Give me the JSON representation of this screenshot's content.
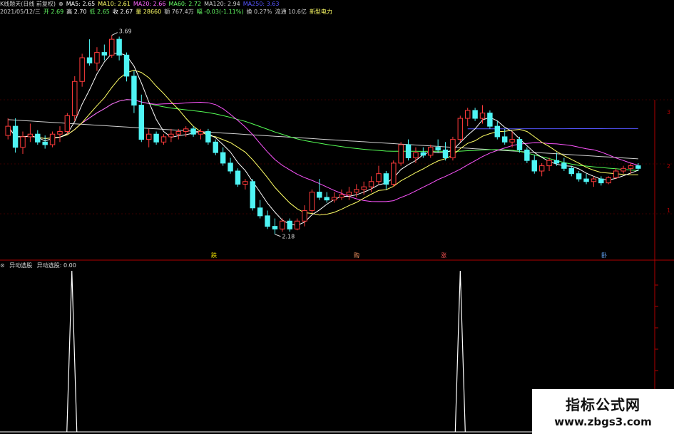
{
  "header": {
    "line1": [
      {
        "text": "K线题天(日线 前复权)",
        "color": "#d0d0d0"
      },
      {
        "text": "⊗",
        "color": "#d0d0d0"
      },
      {
        "text": "MA5: 2.65",
        "color": "#ffffff"
      },
      {
        "text": "MA10: 2.61",
        "color": "#ffff66"
      },
      {
        "text": "MA20: 2.66",
        "color": "#ff66ff"
      },
      {
        "text": "MA60: 2.72",
        "color": "#66ff66"
      },
      {
        "text": "MA120: 2.94",
        "color": "#d0d0d0"
      },
      {
        "text": "MA250: 3.63",
        "color": "#5555ff"
      }
    ],
    "line2": [
      {
        "text": "2021/05/12/三",
        "color": "#d0d0d0"
      },
      {
        "text": "开 2.69",
        "color": "#66ff66"
      },
      {
        "text": "高 2.70",
        "color": "#ffffff"
      },
      {
        "text": "低 2.65",
        "color": "#66ff66"
      },
      {
        "text": "收 2.67",
        "color": "#ffffff"
      },
      {
        "text": "量 28660",
        "color": "#ffff66"
      },
      {
        "text": "额 767.4万",
        "color": "#d0d0d0"
      },
      {
        "text": "幅 -0.03(-1.11%)",
        "color": "#66ff66"
      },
      {
        "text": "换 0.27%",
        "color": "#d0d0d0"
      },
      {
        "text": "流通 10.6亿",
        "color": "#d0d0d0"
      },
      {
        "text": "新型电力",
        "color": "#ffff66"
      }
    ]
  },
  "subpanel": {
    "title": "异动选股",
    "value_label": "异动选股: 0.00"
  },
  "markers": [
    {
      "label": "跌",
      "color": "#ffee00"
    },
    {
      "label": "购",
      "color": "#ff9966"
    },
    {
      "label": "涨",
      "color": "#ff5555"
    },
    {
      "label": "卧",
      "color": "#66aaff"
    }
  ],
  "annotations": {
    "high": "3.69",
    "low": "2.18"
  },
  "axis_labels": [
    "3",
    "2",
    "1"
  ],
  "watermark": {
    "title": "指标公式网",
    "url": "www.zbgs3.com"
  },
  "colors": {
    "up": "#ff3b3b",
    "down": "#4ff4f4",
    "ma5": "#ffffff",
    "ma10": "#ffff66",
    "ma20": "#ff55ff",
    "ma60": "#55ff55",
    "ma120": "#d0d0d0",
    "ma250": "#5555ff"
  },
  "chart_data": {
    "type": "candlestick",
    "ylim": [
      2.0,
      3.85
    ],
    "candles": [
      [
        2.93,
        3.06,
        2.9,
        3.0
      ],
      [
        3.0,
        3.06,
        2.8,
        2.84
      ],
      [
        2.84,
        2.96,
        2.79,
        2.92
      ],
      [
        2.92,
        3.02,
        2.88,
        2.94
      ],
      [
        2.94,
        2.97,
        2.86,
        2.88
      ],
      [
        2.88,
        2.93,
        2.83,
        2.86
      ],
      [
        2.86,
        2.96,
        2.84,
        2.94
      ],
      [
        2.94,
        3.0,
        2.88,
        2.96
      ],
      [
        2.96,
        3.1,
        2.94,
        3.08
      ],
      [
        3.08,
        3.38,
        3.04,
        3.34
      ],
      [
        3.34,
        3.55,
        3.3,
        3.52
      ],
      [
        3.52,
        3.66,
        3.46,
        3.48
      ],
      [
        3.48,
        3.6,
        3.42,
        3.56
      ],
      [
        3.56,
        3.62,
        3.5,
        3.54
      ],
      [
        3.54,
        3.69,
        3.52,
        3.66
      ],
      [
        3.66,
        3.68,
        3.5,
        3.54
      ],
      [
        3.54,
        3.56,
        3.34,
        3.38
      ],
      [
        3.38,
        3.42,
        3.1,
        3.16
      ],
      [
        3.16,
        3.24,
        2.88,
        2.9
      ],
      [
        2.9,
        2.98,
        2.84,
        2.94
      ],
      [
        2.94,
        2.96,
        2.86,
        2.88
      ],
      [
        2.88,
        2.94,
        2.86,
        2.92
      ],
      [
        2.92,
        2.98,
        2.88,
        2.94
      ],
      [
        2.94,
        2.98,
        2.9,
        2.96
      ],
      [
        2.96,
        3.0,
        2.92,
        2.98
      ],
      [
        2.98,
        3.0,
        2.92,
        2.94
      ],
      [
        2.94,
        2.98,
        2.9,
        2.96
      ],
      [
        2.96,
        2.98,
        2.86,
        2.88
      ],
      [
        2.88,
        2.9,
        2.78,
        2.8
      ],
      [
        2.8,
        2.84,
        2.7,
        2.72
      ],
      [
        2.72,
        2.76,
        2.64,
        2.66
      ],
      [
        2.66,
        2.68,
        2.54,
        2.56
      ],
      [
        2.56,
        2.6,
        2.52,
        2.58
      ],
      [
        2.58,
        2.6,
        2.36,
        2.38
      ],
      [
        2.38,
        2.44,
        2.3,
        2.32
      ],
      [
        2.32,
        2.36,
        2.22,
        2.24
      ],
      [
        2.24,
        2.3,
        2.18,
        2.22
      ],
      [
        2.22,
        2.3,
        2.2,
        2.28
      ],
      [
        2.28,
        2.3,
        2.2,
        2.22
      ],
      [
        2.22,
        2.3,
        2.21,
        2.28
      ],
      [
        2.28,
        2.4,
        2.24,
        2.36
      ],
      [
        2.36,
        2.52,
        2.34,
        2.5
      ],
      [
        2.5,
        2.6,
        2.44,
        2.46
      ],
      [
        2.46,
        2.5,
        2.42,
        2.44
      ],
      [
        2.44,
        2.5,
        2.42,
        2.46
      ],
      [
        2.46,
        2.52,
        2.44,
        2.48
      ],
      [
        2.48,
        2.54,
        2.44,
        2.5
      ],
      [
        2.5,
        2.56,
        2.46,
        2.52
      ],
      [
        2.52,
        2.58,
        2.48,
        2.54
      ],
      [
        2.54,
        2.62,
        2.5,
        2.58
      ],
      [
        2.58,
        2.7,
        2.56,
        2.64
      ],
      [
        2.64,
        2.66,
        2.52,
        2.56
      ],
      [
        2.56,
        2.74,
        2.54,
        2.72
      ],
      [
        2.72,
        2.88,
        2.7,
        2.86
      ],
      [
        2.86,
        2.9,
        2.74,
        2.76
      ],
      [
        2.76,
        2.84,
        2.72,
        2.8
      ],
      [
        2.8,
        2.84,
        2.76,
        2.78
      ],
      [
        2.78,
        2.86,
        2.76,
        2.84
      ],
      [
        2.84,
        2.9,
        2.8,
        2.82
      ],
      [
        2.82,
        2.88,
        2.74,
        2.76
      ],
      [
        2.76,
        2.92,
        2.74,
        2.9
      ],
      [
        2.9,
        3.08,
        2.88,
        3.06
      ],
      [
        3.06,
        3.14,
        3.0,
        3.12
      ],
      [
        3.12,
        3.14,
        3.04,
        3.06
      ],
      [
        3.06,
        3.16,
        3.02,
        3.1
      ],
      [
        3.1,
        3.12,
        2.98,
        3.0
      ],
      [
        3.0,
        3.04,
        2.9,
        2.92
      ],
      [
        2.92,
        2.98,
        2.86,
        2.88
      ],
      [
        2.88,
        2.96,
        2.84,
        2.9
      ],
      [
        2.9,
        2.92,
        2.8,
        2.82
      ],
      [
        2.82,
        2.84,
        2.72,
        2.74
      ],
      [
        2.74,
        2.78,
        2.64,
        2.66
      ],
      [
        2.66,
        2.72,
        2.62,
        2.7
      ],
      [
        2.7,
        2.76,
        2.66,
        2.74
      ],
      [
        2.74,
        2.8,
        2.7,
        2.72
      ],
      [
        2.72,
        2.76,
        2.66,
        2.68
      ],
      [
        2.68,
        2.7,
        2.62,
        2.64
      ],
      [
        2.64,
        2.66,
        2.58,
        2.6
      ],
      [
        2.6,
        2.64,
        2.56,
        2.58
      ],
      [
        2.58,
        2.62,
        2.54,
        2.6
      ],
      [
        2.6,
        2.62,
        2.55,
        2.57
      ],
      [
        2.57,
        2.62,
        2.56,
        2.61
      ],
      [
        2.61,
        2.68,
        2.6,
        2.66
      ],
      [
        2.66,
        2.7,
        2.64,
        2.68
      ],
      [
        2.68,
        2.72,
        2.64,
        2.7
      ],
      [
        2.7,
        2.72,
        2.66,
        2.68
      ]
    ],
    "signal": {
      "ylim": [
        0,
        1
      ],
      "peaks_at_candle_index": [
        9,
        61
      ]
    }
  }
}
